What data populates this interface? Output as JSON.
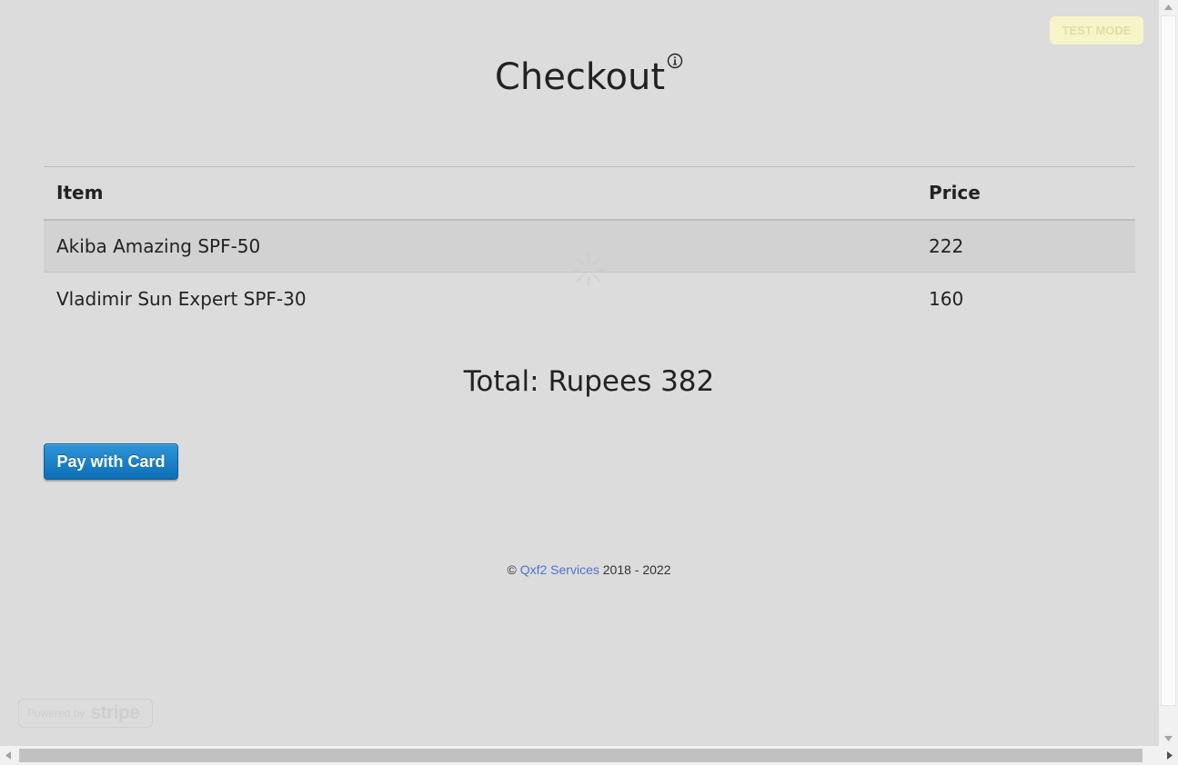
{
  "badge": {
    "test_mode": "TEST MODE"
  },
  "page": {
    "title": "Checkout"
  },
  "table": {
    "headers": {
      "item": "Item",
      "price": "Price"
    },
    "rows": [
      {
        "item": "Akiba Amazing SPF-50",
        "price": "222"
      },
      {
        "item": "Vladimir Sun Expert SPF-30",
        "price": "160"
      }
    ]
  },
  "total": {
    "text": "Total: Rupees 382"
  },
  "pay_button": {
    "label": "Pay with Card"
  },
  "footer": {
    "copyright": "©",
    "company": "Qxf2 Services",
    "years": "2018 - 2022"
  },
  "powered_by": {
    "label": "Powered by",
    "brand": "stripe"
  },
  "colors": {
    "pay_button": "#1a80c8",
    "test_mode_badge": "#fdf9c7",
    "link": "#4a74cf",
    "background": "#dcdcdc"
  },
  "icons": {
    "info": "info-icon",
    "spinner": "loading-spinner-icon"
  }
}
